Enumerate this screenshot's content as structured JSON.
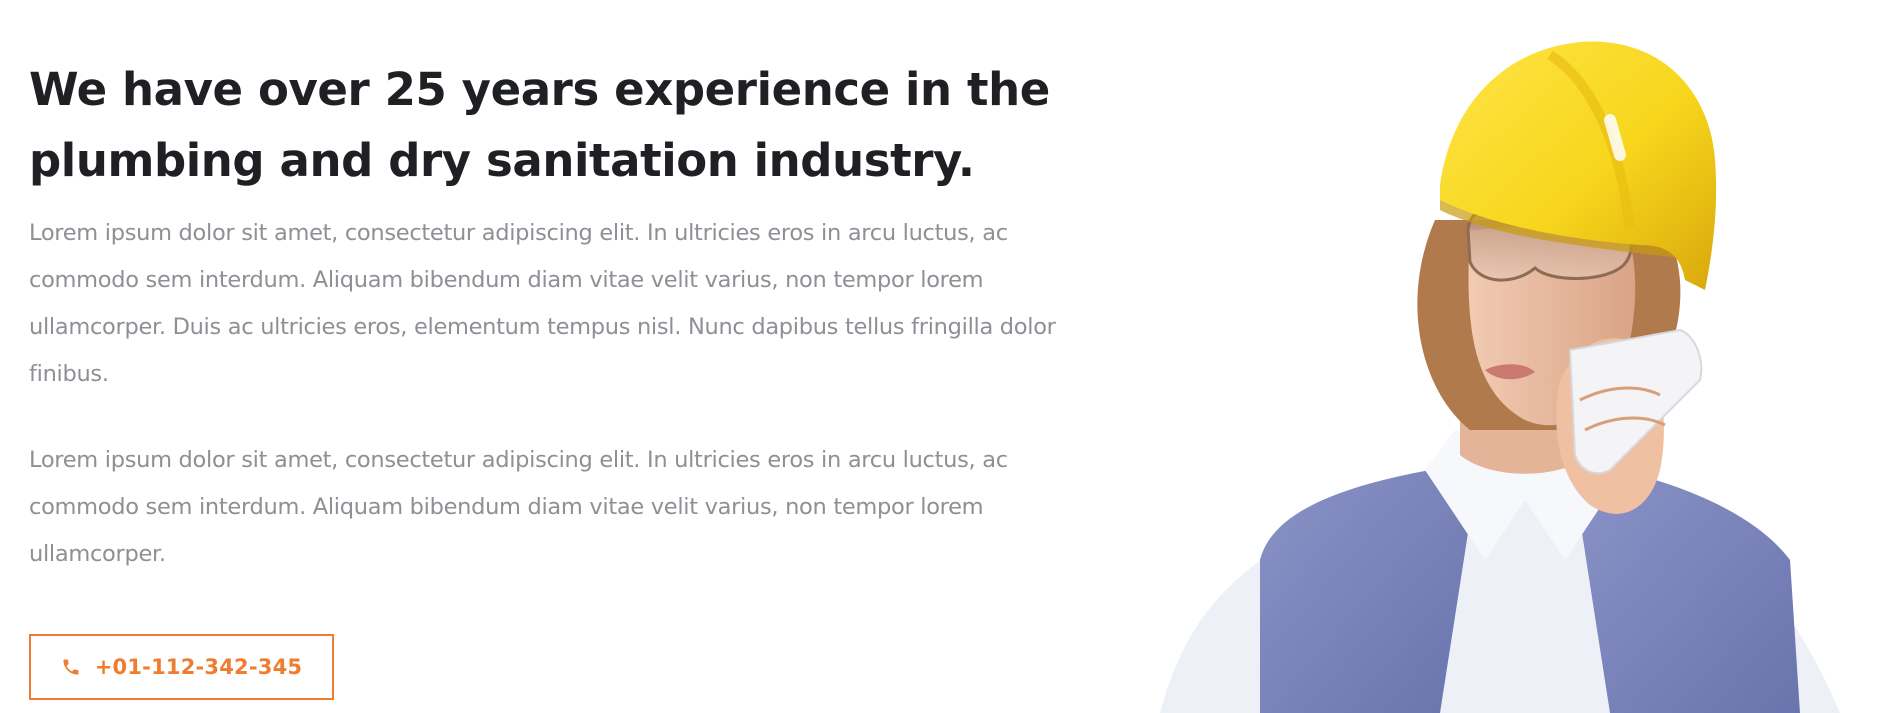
{
  "about": {
    "heading": "We have over 25 years experience in the plumbing and dry sanitation industry.",
    "paragraph_1": "Lorem ipsum dolor sit amet, consectetur adipiscing elit. In ultricies eros in arcu luctus, ac commodo sem interdum. Aliquam bibendum diam vitae velit varius, non tempor lorem ullamcorper. Duis ac ultricies eros, elementum tempus nisl. Nunc dapibus tellus fringilla dolor finibus.",
    "paragraph_2": "Lorem ipsum dolor sit amet, consectetur adipiscing elit. In ultricies eros in arcu luctus, ac commodo sem interdum. Aliquam bibendum diam vitae velit varius, non tempor lorem ullamcorper.",
    "phone_button": {
      "label": "+01-112-342-345",
      "icon": "phone-icon"
    }
  },
  "image": {
    "subject": "worker-photo"
  },
  "colors": {
    "accent": "#f07c2f",
    "heading": "#1f2024",
    "body_text": "#8f8f95",
    "helmet": "#f7d61c"
  }
}
